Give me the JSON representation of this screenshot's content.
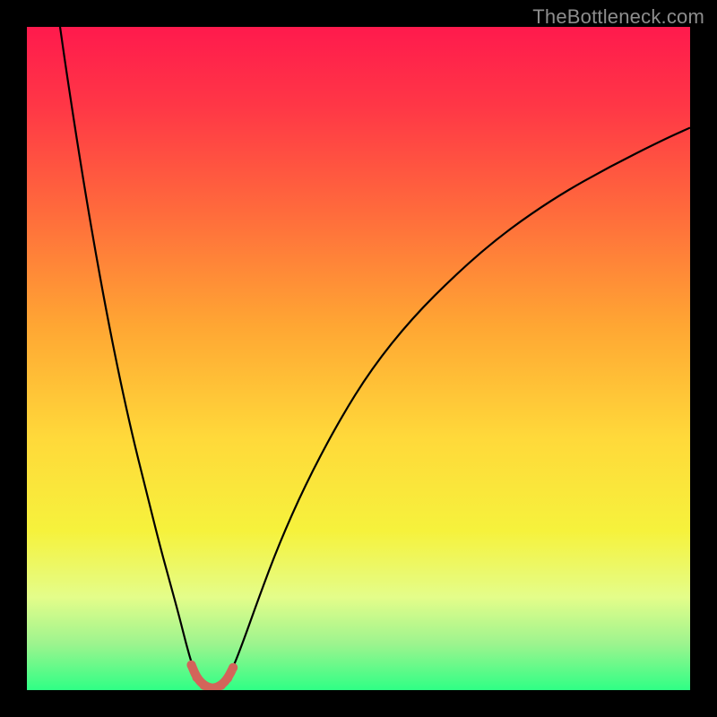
{
  "watermark": "TheBottleneck.com",
  "chart_data": {
    "type": "line",
    "title": "",
    "xlabel": "",
    "ylabel": "",
    "xlim": [
      0,
      100
    ],
    "ylim": [
      0,
      100
    ],
    "grid": false,
    "legend": false,
    "background_gradient_stops": [
      {
        "offset": 0.0,
        "color": "#ff1a4d"
      },
      {
        "offset": 0.12,
        "color": "#ff3746"
      },
      {
        "offset": 0.28,
        "color": "#ff6b3c"
      },
      {
        "offset": 0.45,
        "color": "#ffa633"
      },
      {
        "offset": 0.62,
        "color": "#ffd93a"
      },
      {
        "offset": 0.76,
        "color": "#f6f23c"
      },
      {
        "offset": 0.86,
        "color": "#e4fd8a"
      },
      {
        "offset": 0.93,
        "color": "#9df48e"
      },
      {
        "offset": 1.0,
        "color": "#2fff85"
      }
    ],
    "series": [
      {
        "name": "bottleneck-curve",
        "stroke": "#000000",
        "stroke_width": 2.2,
        "points": [
          {
            "x": 5.0,
            "y": 100.0
          },
          {
            "x": 6.0,
            "y": 93.0
          },
          {
            "x": 8.0,
            "y": 80.0
          },
          {
            "x": 10.0,
            "y": 68.0
          },
          {
            "x": 12.0,
            "y": 57.0
          },
          {
            "x": 14.0,
            "y": 47.0
          },
          {
            "x": 16.0,
            "y": 38.0
          },
          {
            "x": 18.0,
            "y": 30.0
          },
          {
            "x": 20.0,
            "y": 22.0
          },
          {
            "x": 21.5,
            "y": 16.5
          },
          {
            "x": 23.0,
            "y": 11.0
          },
          {
            "x": 24.0,
            "y": 7.0
          },
          {
            "x": 25.0,
            "y": 3.5
          },
          {
            "x": 26.0,
            "y": 1.3
          },
          {
            "x": 27.0,
            "y": 0.4
          },
          {
            "x": 28.0,
            "y": 0.0
          },
          {
            "x": 29.0,
            "y": 0.4
          },
          {
            "x": 30.0,
            "y": 1.3
          },
          {
            "x": 31.0,
            "y": 3.2
          },
          {
            "x": 32.5,
            "y": 7.0
          },
          {
            "x": 35.0,
            "y": 14.0
          },
          {
            "x": 38.0,
            "y": 22.0
          },
          {
            "x": 42.0,
            "y": 31.0
          },
          {
            "x": 47.0,
            "y": 40.5
          },
          {
            "x": 52.0,
            "y": 48.5
          },
          {
            "x": 58.0,
            "y": 56.0
          },
          {
            "x": 65.0,
            "y": 63.0
          },
          {
            "x": 72.0,
            "y": 69.0
          },
          {
            "x": 80.0,
            "y": 74.5
          },
          {
            "x": 88.0,
            "y": 79.0
          },
          {
            "x": 96.0,
            "y": 83.0
          },
          {
            "x": 100.0,
            "y": 84.8
          }
        ]
      },
      {
        "name": "bottleneck-floor-markers",
        "stroke": "#d3645a",
        "stroke_width": 10,
        "linecap": "round",
        "points": [
          {
            "x": 24.8,
            "y": 3.8
          },
          {
            "x": 25.6,
            "y": 1.9
          },
          {
            "x": 26.7,
            "y": 0.7
          },
          {
            "x": 28.0,
            "y": 0.2
          },
          {
            "x": 29.3,
            "y": 0.7
          },
          {
            "x": 30.3,
            "y": 1.8
          },
          {
            "x": 31.1,
            "y": 3.4
          }
        ]
      }
    ]
  }
}
